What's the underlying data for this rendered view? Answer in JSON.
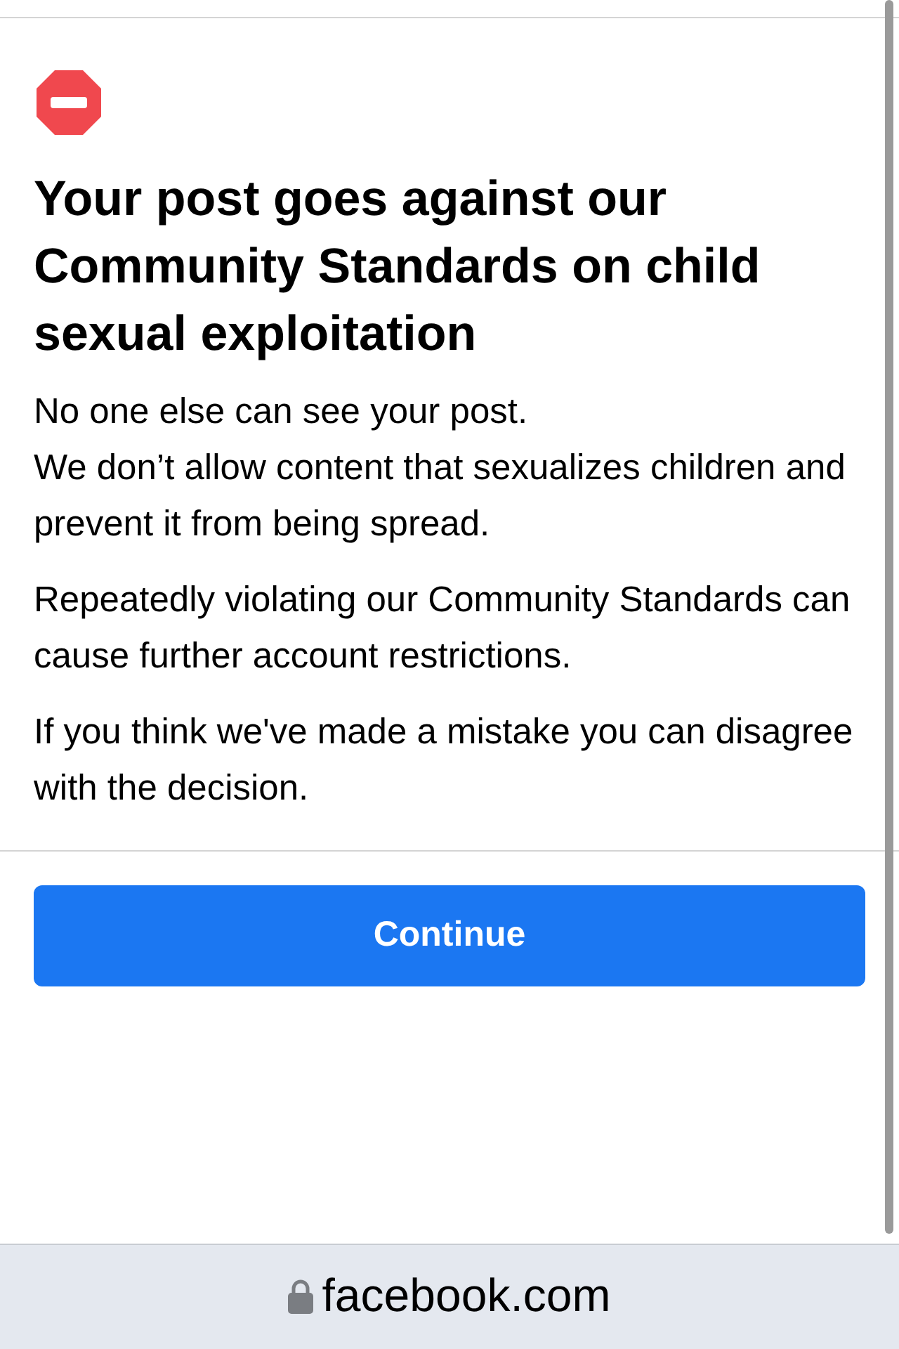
{
  "heading": "Your post goes against our Community Standards on child sexual exploitation",
  "paragraphs": [
    {
      "lines": [
        "No one else can see your post.",
        "We don’t allow content that sexualizes children and prevent it from being spread."
      ]
    },
    {
      "lines": [
        "Repeatedly violating our Community Standards can cause further account restrictions."
      ]
    },
    {
      "lines": [
        "If you think we've made a mistake you can disagree with the decision."
      ]
    }
  ],
  "button": {
    "label": "Continue"
  },
  "address_bar": {
    "url": "facebook.com"
  }
}
